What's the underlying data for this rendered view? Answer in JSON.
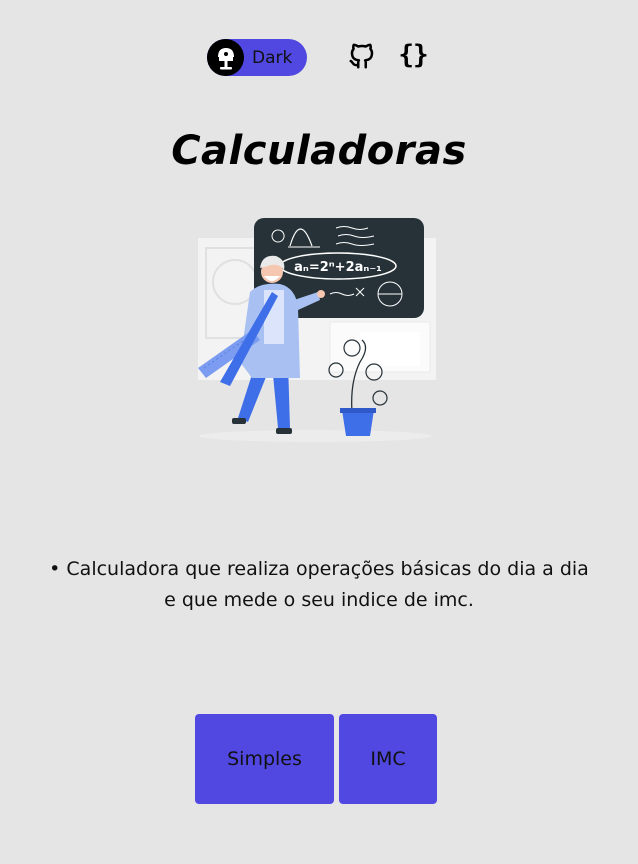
{
  "header": {
    "theme_toggle": {
      "label": "Dark",
      "icon": "lamp-icon"
    },
    "links": [
      {
        "name": "github",
        "icon": "github-icon"
      },
      {
        "name": "code",
        "icon": "code-braces-icon",
        "glyph": "{}"
      }
    ]
  },
  "main": {
    "title": "Calculadoras",
    "illustration": {
      "icon": "teacher-chalkboard-illustration",
      "board_formula": "aₙ=2ⁿ+2aₙ₋₁"
    },
    "description_line1": "• Calculadora que realiza operações básicas do dia a dia",
    "description_line2": "e que mede o seu indice de imc."
  },
  "buttons": {
    "simples": "Simples",
    "imc": "IMC"
  },
  "colors": {
    "background": "#e5e5e5",
    "accent": "#5048e0",
    "chalkboard": "#263238",
    "illustration_blue": "#3f6fe8"
  }
}
